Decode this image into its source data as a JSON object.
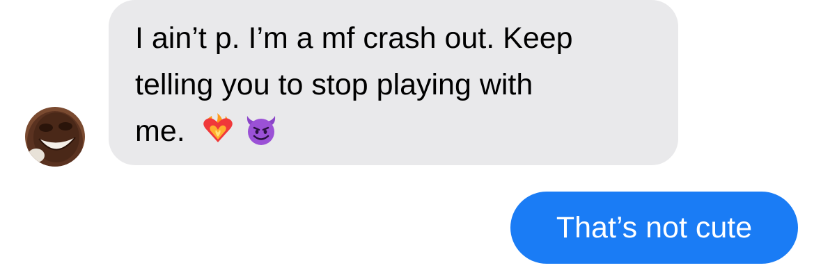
{
  "conversation": {
    "incoming": {
      "line1": "I ain’t p. I’m a mf crash out. Keep",
      "line2": "telling you to stop playing with",
      "line3": "me.",
      "emojis": [
        "heart-on-fire-icon",
        "smiling-devil-icon"
      ]
    },
    "outgoing": {
      "text": "That’s not cute"
    }
  },
  "colors": {
    "incoming_bubble": "#e9e9eb",
    "outgoing_bubble": "#1a7cf5",
    "outgoing_text": "#ffffff"
  }
}
